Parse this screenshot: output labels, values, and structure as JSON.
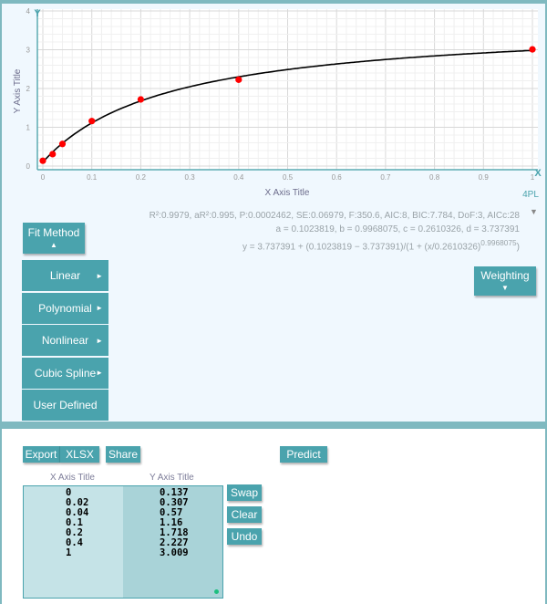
{
  "chart_data": {
    "type": "scatter",
    "xlabel": "X Axis Title",
    "ylabel": "Y Axis Title",
    "xlim": [
      0,
      1
    ],
    "ylim": [
      0,
      4
    ],
    "x_ticks": [
      "0",
      "0.1",
      "0.2",
      "0.3",
      "0.4",
      "0.5",
      "0.6",
      "0.7",
      "0.8",
      "0.9",
      "1"
    ],
    "y_ticks": [
      "0",
      "1",
      "2",
      "3",
      "4"
    ],
    "grid": true,
    "points": {
      "x": [
        0,
        0.02,
        0.04,
        0.1,
        0.2,
        0.4,
        1
      ],
      "y": [
        0.137,
        0.307,
        0.57,
        1.16,
        1.718,
        2.227,
        3.009
      ],
      "color": "#ff0000"
    },
    "fit": {
      "model": "4PL",
      "a": 0.1023819,
      "b": 0.9968075,
      "c": 0.2610326,
      "d": 3.737391,
      "color": "#000000"
    },
    "y_axis_icon": "Y",
    "x_axis_icon": "X",
    "fit_label": "4PL"
  },
  "stats": {
    "line1": "R²:0.9979, aR²:0.995, P:0.0002462, SE:0.06979, F:350.6, AIC:8, BIC:7.784, DoF:3, AICc:28",
    "line2": "a = 0.1023819, b = 0.9968075, c = 0.2610326, d = 3.737391",
    "line3": "y = 3.737391 + (0.1023819 − 3.737391)/(1 + (x/0.2610326)",
    "exponent": "0.9968075",
    "close": ")"
  },
  "fit_method": {
    "label": "Fit Method",
    "arrow": "▲"
  },
  "menu": [
    {
      "label": "Linear",
      "arrow": "►"
    },
    {
      "label": "Polynomial",
      "arrow": "►"
    },
    {
      "label": "Nonlinear",
      "arrow": "►"
    },
    {
      "label": "Cubic Spline",
      "arrow": "►"
    },
    {
      "label": "User Defined",
      "arrow": ""
    }
  ],
  "weighting": {
    "label": "Weighting",
    "arrow": "▼"
  },
  "toolbar": {
    "export": "Export",
    "format": "XLSX ▼",
    "share": "Share",
    "predict": "Predict ▼"
  },
  "table": {
    "x_header": "X Axis Title",
    "y_header": "Y Axis Title",
    "x": [
      "0",
      "0.02",
      "0.04",
      "0.1",
      "0.2",
      "0.4",
      "1"
    ],
    "y": [
      "0.137",
      "0.307",
      "0.57",
      "1.16",
      "1.718",
      "2.227",
      "3.009"
    ]
  },
  "actions": {
    "swap": "Swap",
    "clear": "Clear",
    "undo": "Undo"
  },
  "colors": {
    "accent": "#4aa3ad",
    "frame": "#7fb9c0"
  }
}
